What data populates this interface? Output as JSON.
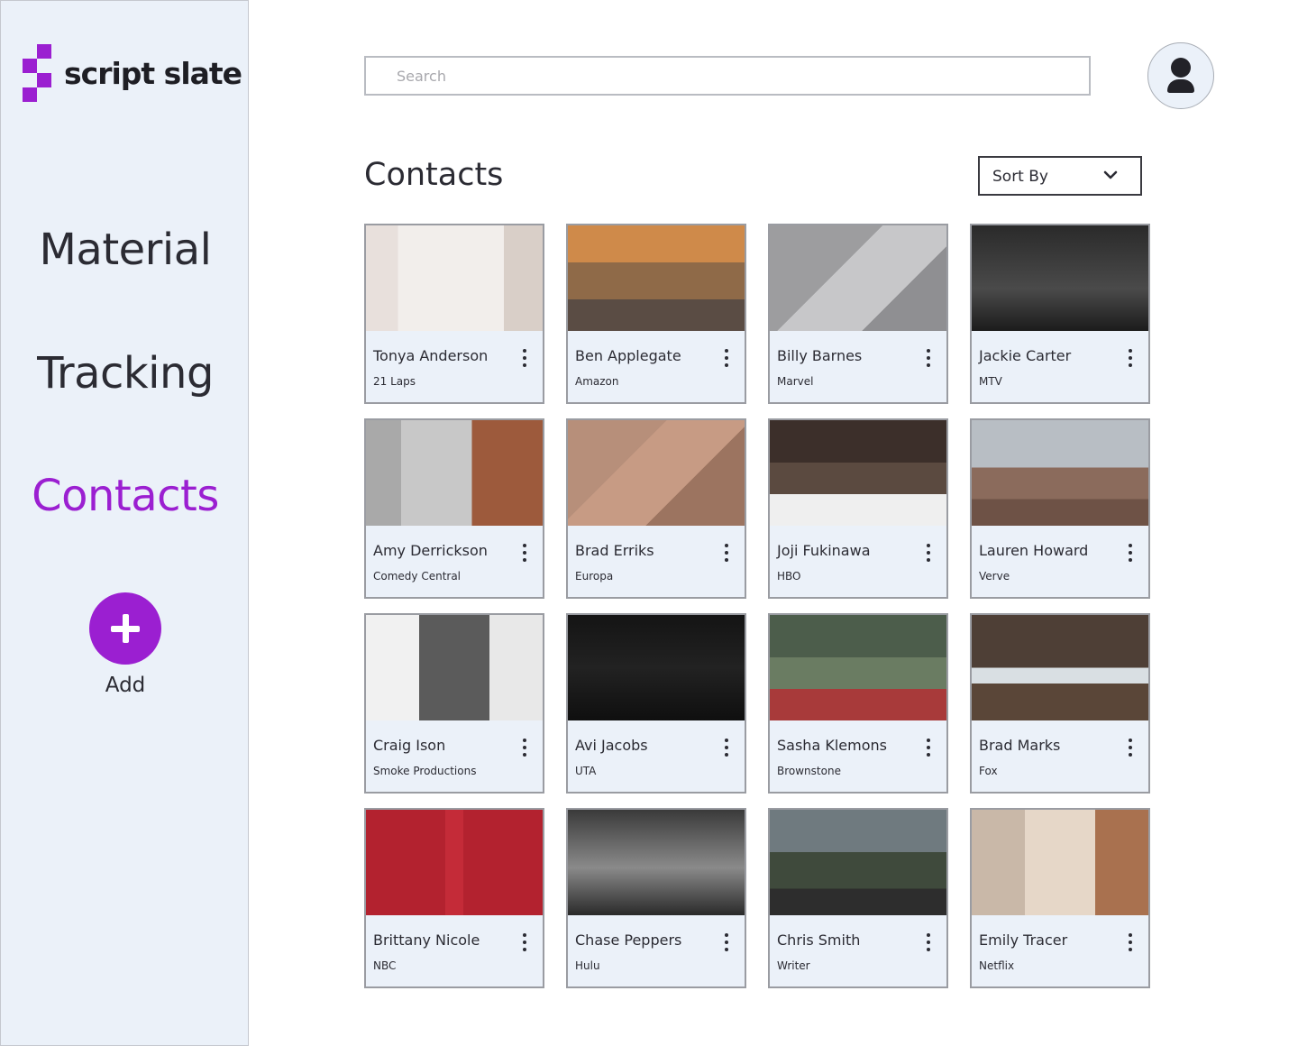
{
  "brand": {
    "name": "script slate",
    "accent": "#9b1fd1",
    "sidebar_bg": "#ebf1f9"
  },
  "sidebar": {
    "items": [
      {
        "label": "Material",
        "active": false
      },
      {
        "label": "Tracking",
        "active": false
      },
      {
        "label": "Contacts",
        "active": true
      }
    ],
    "add_label": "Add"
  },
  "search": {
    "placeholder": "Search",
    "value": ""
  },
  "header": {
    "title": "Contacts",
    "sort_label": "Sort By"
  },
  "contacts": [
    {
      "name": "Tonya Anderson",
      "org": "21 Laps"
    },
    {
      "name": "Ben Applegate",
      "org": "Amazon"
    },
    {
      "name": "Billy Barnes",
      "org": "Marvel"
    },
    {
      "name": "Jackie Carter",
      "org": "MTV"
    },
    {
      "name": "Amy Derrickson",
      "org": "Comedy Central"
    },
    {
      "name": "Brad Erriks",
      "org": "Europa"
    },
    {
      "name": "Joji Fukinawa",
      "org": "HBO"
    },
    {
      "name": "Lauren Howard",
      "org": "Verve"
    },
    {
      "name": "Craig Ison",
      "org": "Smoke Productions"
    },
    {
      "name": "Avi Jacobs",
      "org": "UTA"
    },
    {
      "name": "Sasha Klemons",
      "org": "Brownstone"
    },
    {
      "name": "Brad Marks",
      "org": "Fox"
    },
    {
      "name": "Brittany Nicole",
      "org": "NBC"
    },
    {
      "name": "Chase Peppers",
      "org": "Hulu"
    },
    {
      "name": "Chris Smith",
      "org": "Writer"
    },
    {
      "name": "Emily Tracer",
      "org": "Netflix"
    }
  ]
}
